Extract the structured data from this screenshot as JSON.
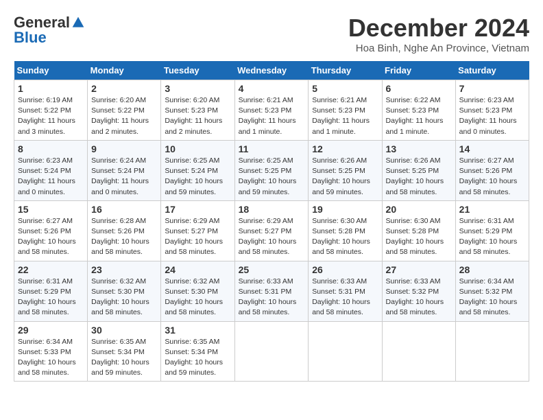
{
  "header": {
    "logo_general": "General",
    "logo_blue": "Blue",
    "month_title": "December 2024",
    "location": "Hoa Binh, Nghe An Province, Vietnam"
  },
  "days_of_week": [
    "Sunday",
    "Monday",
    "Tuesday",
    "Wednesday",
    "Thursday",
    "Friday",
    "Saturday"
  ],
  "weeks": [
    [
      {
        "day": 1,
        "info": "Sunrise: 6:19 AM\nSunset: 5:22 PM\nDaylight: 11 hours\nand 3 minutes."
      },
      {
        "day": 2,
        "info": "Sunrise: 6:20 AM\nSunset: 5:22 PM\nDaylight: 11 hours\nand 2 minutes."
      },
      {
        "day": 3,
        "info": "Sunrise: 6:20 AM\nSunset: 5:23 PM\nDaylight: 11 hours\nand 2 minutes."
      },
      {
        "day": 4,
        "info": "Sunrise: 6:21 AM\nSunset: 5:23 PM\nDaylight: 11 hours\nand 1 minute."
      },
      {
        "day": 5,
        "info": "Sunrise: 6:21 AM\nSunset: 5:23 PM\nDaylight: 11 hours\nand 1 minute."
      },
      {
        "day": 6,
        "info": "Sunrise: 6:22 AM\nSunset: 5:23 PM\nDaylight: 11 hours\nand 1 minute."
      },
      {
        "day": 7,
        "info": "Sunrise: 6:23 AM\nSunset: 5:23 PM\nDaylight: 11 hours\nand 0 minutes."
      }
    ],
    [
      {
        "day": 8,
        "info": "Sunrise: 6:23 AM\nSunset: 5:24 PM\nDaylight: 11 hours\nand 0 minutes."
      },
      {
        "day": 9,
        "info": "Sunrise: 6:24 AM\nSunset: 5:24 PM\nDaylight: 11 hours\nand 0 minutes."
      },
      {
        "day": 10,
        "info": "Sunrise: 6:25 AM\nSunset: 5:24 PM\nDaylight: 10 hours\nand 59 minutes."
      },
      {
        "day": 11,
        "info": "Sunrise: 6:25 AM\nSunset: 5:25 PM\nDaylight: 10 hours\nand 59 minutes."
      },
      {
        "day": 12,
        "info": "Sunrise: 6:26 AM\nSunset: 5:25 PM\nDaylight: 10 hours\nand 59 minutes."
      },
      {
        "day": 13,
        "info": "Sunrise: 6:26 AM\nSunset: 5:25 PM\nDaylight: 10 hours\nand 58 minutes."
      },
      {
        "day": 14,
        "info": "Sunrise: 6:27 AM\nSunset: 5:26 PM\nDaylight: 10 hours\nand 58 minutes."
      }
    ],
    [
      {
        "day": 15,
        "info": "Sunrise: 6:27 AM\nSunset: 5:26 PM\nDaylight: 10 hours\nand 58 minutes."
      },
      {
        "day": 16,
        "info": "Sunrise: 6:28 AM\nSunset: 5:26 PM\nDaylight: 10 hours\nand 58 minutes."
      },
      {
        "day": 17,
        "info": "Sunrise: 6:29 AM\nSunset: 5:27 PM\nDaylight: 10 hours\nand 58 minutes."
      },
      {
        "day": 18,
        "info": "Sunrise: 6:29 AM\nSunset: 5:27 PM\nDaylight: 10 hours\nand 58 minutes."
      },
      {
        "day": 19,
        "info": "Sunrise: 6:30 AM\nSunset: 5:28 PM\nDaylight: 10 hours\nand 58 minutes."
      },
      {
        "day": 20,
        "info": "Sunrise: 6:30 AM\nSunset: 5:28 PM\nDaylight: 10 hours\nand 58 minutes."
      },
      {
        "day": 21,
        "info": "Sunrise: 6:31 AM\nSunset: 5:29 PM\nDaylight: 10 hours\nand 58 minutes."
      }
    ],
    [
      {
        "day": 22,
        "info": "Sunrise: 6:31 AM\nSunset: 5:29 PM\nDaylight: 10 hours\nand 58 minutes."
      },
      {
        "day": 23,
        "info": "Sunrise: 6:32 AM\nSunset: 5:30 PM\nDaylight: 10 hours\nand 58 minutes."
      },
      {
        "day": 24,
        "info": "Sunrise: 6:32 AM\nSunset: 5:30 PM\nDaylight: 10 hours\nand 58 minutes."
      },
      {
        "day": 25,
        "info": "Sunrise: 6:33 AM\nSunset: 5:31 PM\nDaylight: 10 hours\nand 58 minutes."
      },
      {
        "day": 26,
        "info": "Sunrise: 6:33 AM\nSunset: 5:31 PM\nDaylight: 10 hours\nand 58 minutes."
      },
      {
        "day": 27,
        "info": "Sunrise: 6:33 AM\nSunset: 5:32 PM\nDaylight: 10 hours\nand 58 minutes."
      },
      {
        "day": 28,
        "info": "Sunrise: 6:34 AM\nSunset: 5:32 PM\nDaylight: 10 hours\nand 58 minutes."
      }
    ],
    [
      {
        "day": 29,
        "info": "Sunrise: 6:34 AM\nSunset: 5:33 PM\nDaylight: 10 hours\nand 58 minutes."
      },
      {
        "day": 30,
        "info": "Sunrise: 6:35 AM\nSunset: 5:34 PM\nDaylight: 10 hours\nand 59 minutes."
      },
      {
        "day": 31,
        "info": "Sunrise: 6:35 AM\nSunset: 5:34 PM\nDaylight: 10 hours\nand 59 minutes."
      },
      null,
      null,
      null,
      null
    ]
  ]
}
